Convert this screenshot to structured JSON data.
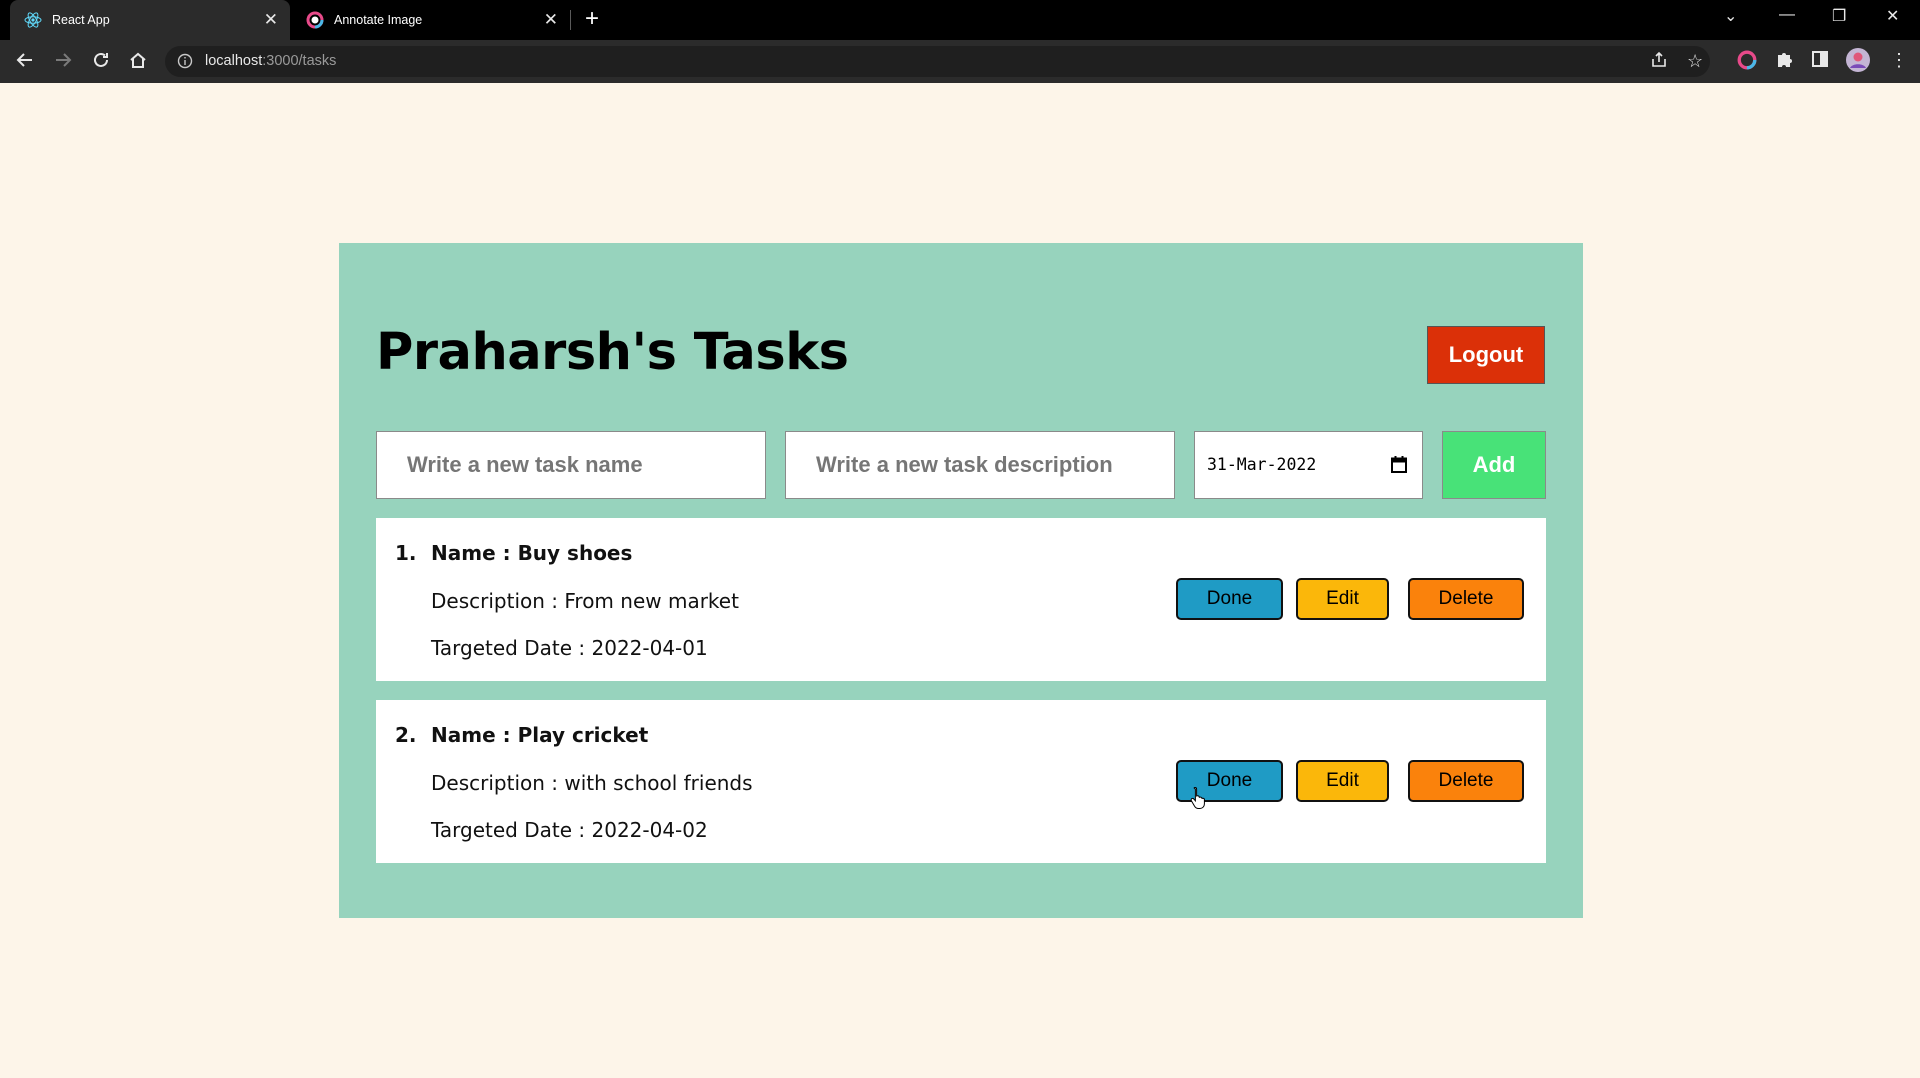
{
  "browser": {
    "tabs": [
      {
        "title": "React App",
        "icon": "react-icon",
        "active": true
      },
      {
        "title": "Annotate Image",
        "icon": "annotate-icon",
        "active": false
      }
    ],
    "url_host": "localhost",
    "url_path": ":3000/tasks"
  },
  "app": {
    "title": "Praharsh's Tasks",
    "logout_label": "Logout",
    "new_task": {
      "name_placeholder": "Write a new task name",
      "description_placeholder": "Write a new task description",
      "date_value": "31-Mar-2022",
      "add_label": "Add"
    },
    "tasks": [
      {
        "number": "1.",
        "name": "Name : Buy shoes",
        "description": "Description : From new market",
        "date": "Targeted Date : 2022-04-01",
        "done_label": "Done",
        "edit_label": "Edit",
        "delete_label": "Delete"
      },
      {
        "number": "2.",
        "name": "Name : Play cricket",
        "description": "Description : with school friends",
        "date": "Targeted Date : 2022-04-02",
        "done_label": "Done",
        "edit_label": "Edit",
        "delete_label": "Delete"
      }
    ]
  },
  "colors": {
    "page_bg": "#fdf5e9",
    "card_bg": "#97d3bd",
    "logout": "#db3008",
    "add": "#48e278",
    "done": "#1f9bc5",
    "edit": "#fbb70a",
    "delete": "#fa820c"
  }
}
